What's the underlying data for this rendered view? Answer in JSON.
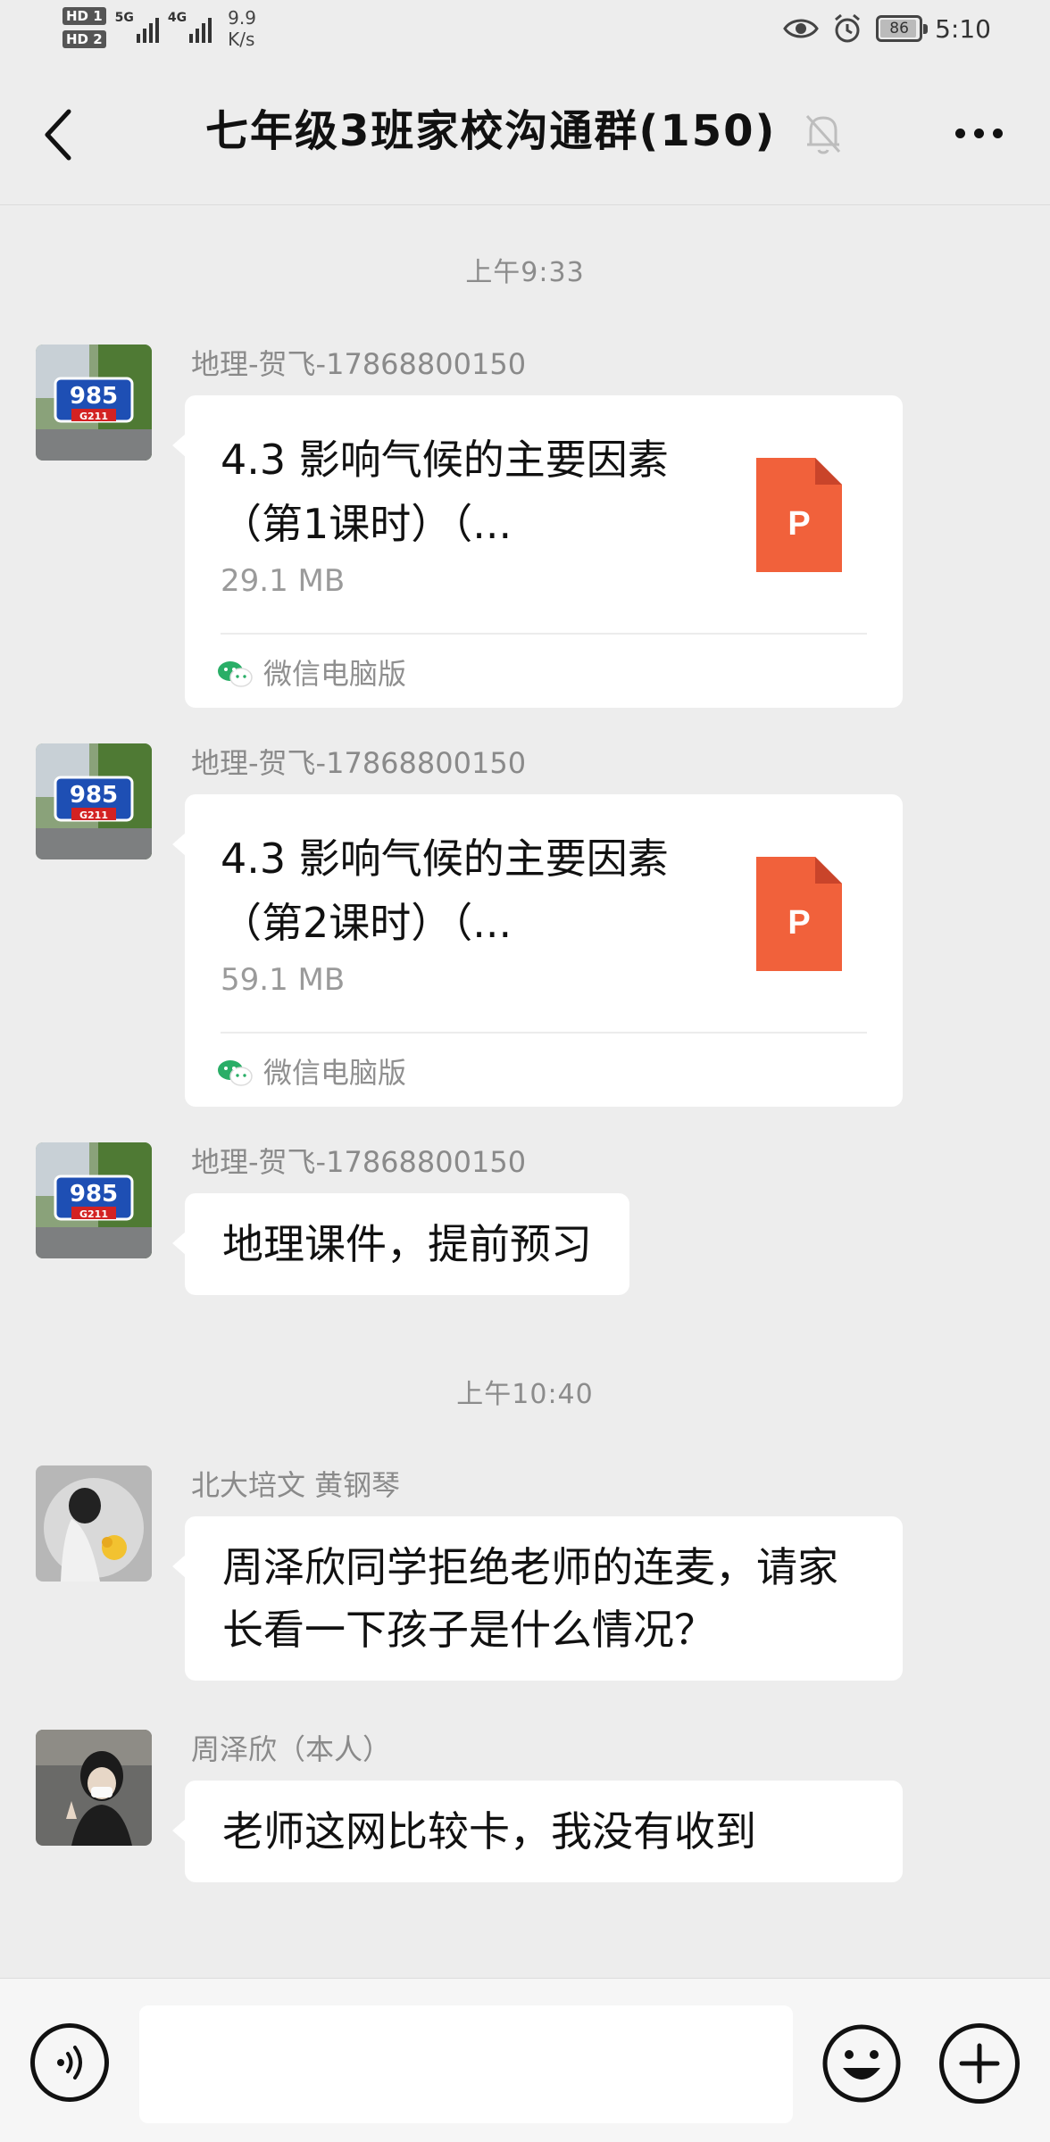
{
  "status_bar": {
    "hd1": "HD 1",
    "hd2": "HD 2",
    "net1": "5G",
    "net2": "4G",
    "speed_value": "9.9",
    "speed_unit": "K/s",
    "battery": "86",
    "time": "5:10"
  },
  "nav": {
    "title": "七年级3班家校沟通群(150)"
  },
  "chat": {
    "timestamps": [
      "上午9:33",
      "上午10:40"
    ],
    "messages": [
      {
        "sender": "地理-贺飞-17868800150",
        "type": "file",
        "file_name": "4.3 影响气候的主要因素（第1课时）（...",
        "file_size": "29.1 MB",
        "source": "微信电脑版",
        "file_icon_letter": "P"
      },
      {
        "sender": "地理-贺飞-17868800150",
        "type": "file",
        "file_name": "4.3 影响气候的主要因素（第2课时）（...",
        "file_size": "59.1 MB",
        "source": "微信电脑版",
        "file_icon_letter": "P"
      },
      {
        "sender": "地理-贺飞-17868800150",
        "type": "text",
        "text": "地理课件，提前预习"
      },
      {
        "sender": "北大培文 黄钢琴",
        "type": "text",
        "text": "周泽欣同学拒绝老师的连麦，请家长看一下孩子是什么情况？"
      },
      {
        "sender": "周泽欣（本人）",
        "type": "text",
        "text": "老师这网比较卡，我没有收到"
      }
    ],
    "avatar_badge": {
      "number": "985",
      "road": "G211"
    }
  },
  "input_bar": {
    "placeholder": ""
  },
  "colors": {
    "background": "#ededed",
    "bubble": "#ffffff",
    "ppt_icon": "#f1613b",
    "wechat_green": "#2aae67"
  }
}
